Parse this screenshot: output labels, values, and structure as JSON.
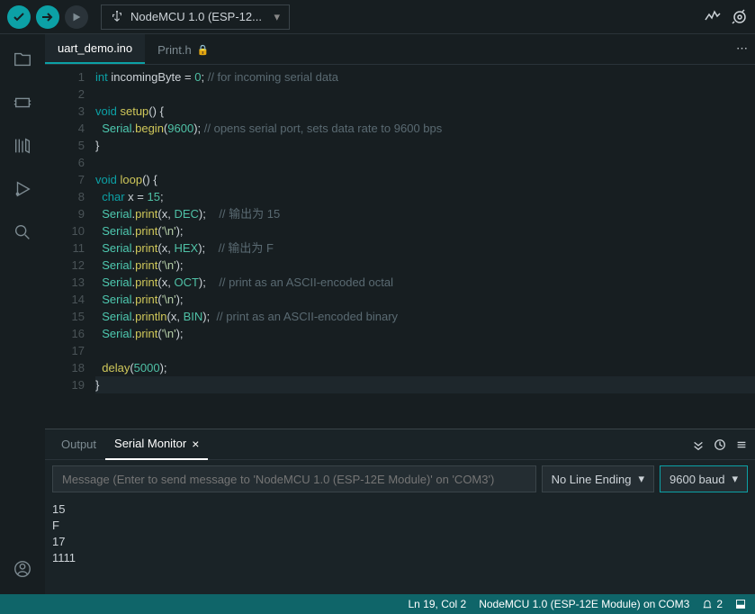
{
  "toolbar": {
    "board_name": "NodeMCU 1.0 (ESP-12..."
  },
  "tabs": {
    "active": "uart_demo.ino",
    "secondary": "Print.h"
  },
  "code": {
    "lines": [
      {
        "n": 1,
        "html": "<span class='kw'>int</span> <span class='ident'>incomingByte</span> = <span class='num'>0</span>; <span class='comment'>// for incoming serial data</span>"
      },
      {
        "n": 2,
        "html": ""
      },
      {
        "n": 3,
        "html": "<span class='kw'>void</span> <span class='func'>setup</span>() {"
      },
      {
        "n": 4,
        "html": "  <span class='obj'>Serial</span>.<span class='func'>begin</span>(<span class='num'>9600</span>); <span class='comment'>// opens serial port, sets data rate to 9600 bps</span>"
      },
      {
        "n": 5,
        "html": "}"
      },
      {
        "n": 6,
        "html": ""
      },
      {
        "n": 7,
        "html": "<span class='kw'>void</span> <span class='func'>loop</span>() {"
      },
      {
        "n": 8,
        "html": "  <span class='kw'>char</span> x = <span class='num'>15</span>;"
      },
      {
        "n": 9,
        "html": "  <span class='obj'>Serial</span>.<span class='func'>print</span>(x, <span class='num'>DEC</span>);    <span class='comment'>// 输出为 15</span>"
      },
      {
        "n": 10,
        "html": "  <span class='obj'>Serial</span>.<span class='func'>print</span>(<span class='str'>'\\n'</span>);"
      },
      {
        "n": 11,
        "html": "  <span class='obj'>Serial</span>.<span class='func'>print</span>(x, <span class='num'>HEX</span>);    <span class='comment'>// 输出为 F</span>"
      },
      {
        "n": 12,
        "html": "  <span class='obj'>Serial</span>.<span class='func'>print</span>(<span class='str'>'\\n'</span>);"
      },
      {
        "n": 13,
        "html": "  <span class='obj'>Serial</span>.<span class='func'>print</span>(x, <span class='num'>OCT</span>);    <span class='comment'>// print as an ASCII-encoded octal</span>"
      },
      {
        "n": 14,
        "html": "  <span class='obj'>Serial</span>.<span class='func'>print</span>(<span class='str'>'\\n'</span>);"
      },
      {
        "n": 15,
        "html": "  <span class='obj'>Serial</span>.<span class='func'>println</span>(x, <span class='num'>BIN</span>);  <span class='comment'>// print as an ASCII-encoded binary</span>"
      },
      {
        "n": 16,
        "html": "  <span class='obj'>Serial</span>.<span class='func'>print</span>(<span class='str'>'\\n'</span>);"
      },
      {
        "n": 17,
        "html": ""
      },
      {
        "n": 18,
        "html": "  <span class='func'>delay</span>(<span class='num'>5000</span>);"
      },
      {
        "n": 19,
        "html": "}",
        "current": true
      }
    ]
  },
  "panel": {
    "tabs": {
      "output": "Output",
      "serial": "Serial Monitor"
    },
    "input_placeholder": "Message (Enter to send message to 'NodeMCU 1.0 (ESP-12E Module)' on 'COM3')",
    "line_ending": "No Line Ending",
    "baud": "9600 baud",
    "output_lines": [
      "15",
      "F",
      "17",
      "1111"
    ]
  },
  "status": {
    "cursor": "Ln 19, Col 2",
    "board": "NodeMCU 1.0 (ESP-12E Module) on COM3",
    "notifications": "2"
  }
}
